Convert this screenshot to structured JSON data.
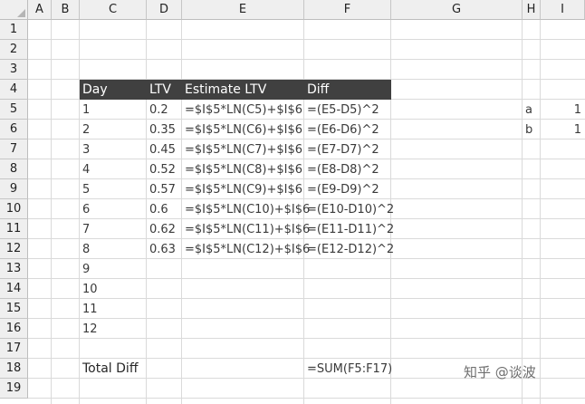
{
  "columns": [
    "A",
    "B",
    "C",
    "D",
    "E",
    "F",
    "G",
    "H",
    "I"
  ],
  "rows": [
    "1",
    "2",
    "3",
    "4",
    "5",
    "6",
    "7",
    "8",
    "9",
    "10",
    "11",
    "12",
    "13",
    "14",
    "15",
    "16",
    "17",
    "18",
    "19"
  ],
  "table": {
    "headers": {
      "day": "Day",
      "ltv": "LTV",
      "estimate": "Estimate LTV",
      "diff": "Diff"
    },
    "rows": [
      {
        "day": "1",
        "ltv": "0.2",
        "estimate": "=$I$5*LN(C5)+$I$6",
        "diff": "=(E5-D5)^2"
      },
      {
        "day": "2",
        "ltv": "0.35",
        "estimate": "=$I$5*LN(C6)+$I$6",
        "diff": "=(E6-D6)^2"
      },
      {
        "day": "3",
        "ltv": "0.45",
        "estimate": "=$I$5*LN(C7)+$I$6",
        "diff": "=(E7-D7)^2"
      },
      {
        "day": "4",
        "ltv": "0.52",
        "estimate": "=$I$5*LN(C8)+$I$6",
        "diff": "=(E8-D8)^2"
      },
      {
        "day": "5",
        "ltv": "0.57",
        "estimate": "=$I$5*LN(C9)+$I$6",
        "diff": "=(E9-D9)^2"
      },
      {
        "day": "6",
        "ltv": "0.6",
        "estimate": "=$I$5*LN(C10)+$I$6",
        "diff": "=(E10-D10)^2"
      },
      {
        "day": "7",
        "ltv": "0.62",
        "estimate": "=$I$5*LN(C11)+$I$6",
        "diff": "=(E11-D11)^2"
      },
      {
        "day": "8",
        "ltv": "0.63",
        "estimate": "=$I$5*LN(C12)+$I$6",
        "diff": "=(E12-D12)^2"
      },
      {
        "day": "9",
        "ltv": "",
        "estimate": "",
        "diff": ""
      },
      {
        "day": "10",
        "ltv": "",
        "estimate": "",
        "diff": ""
      },
      {
        "day": "11",
        "ltv": "",
        "estimate": "",
        "diff": ""
      },
      {
        "day": "12",
        "ltv": "",
        "estimate": "",
        "diff": ""
      }
    ],
    "total_label": "Total Diff",
    "total_formula": "=SUM(F5:F17)"
  },
  "params": {
    "a_label": "a",
    "a_value": "1",
    "b_label": "b",
    "b_value": "1"
  },
  "watermark": "知乎 @谈波",
  "colors": {
    "header_band": "#404040",
    "header_text": "#ffffff",
    "grid": "#dadada",
    "header_bg": "#efefef"
  }
}
